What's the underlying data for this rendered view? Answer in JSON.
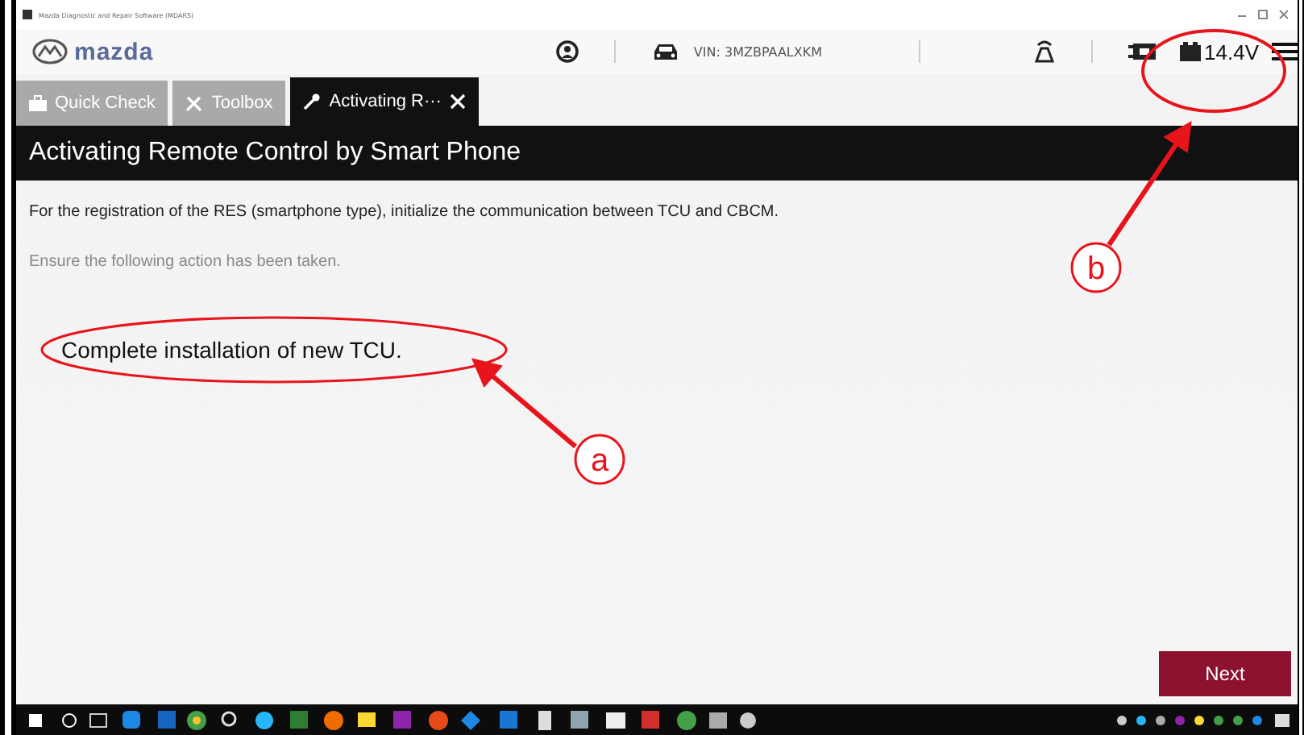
{
  "window": {
    "title": "Mazda Diagnostic and Repair Software (MDARS)"
  },
  "header": {
    "brand": "mazda",
    "vin": "VIN: 3MZBPAALXKM",
    "voltage": "14.4V"
  },
  "tabs": [
    {
      "label": "Quick Check",
      "selected": false,
      "closable": false
    },
    {
      "label": "Toolbox",
      "selected": false,
      "closable": false
    },
    {
      "label": "Activating R···",
      "selected": true,
      "closable": true
    }
  ],
  "page": {
    "title": "Activating Remote Control by Smart Phone",
    "description": "For the registration of the RES (smartphone type), initialize the communication between TCU and CBCM.",
    "instruction": "Ensure the following action has been taken.",
    "action": "Complete installation of new TCU."
  },
  "buttons": [
    {
      "label": "Next"
    }
  ],
  "annotations": [
    {
      "label": "a"
    },
    {
      "label": "b"
    }
  ]
}
